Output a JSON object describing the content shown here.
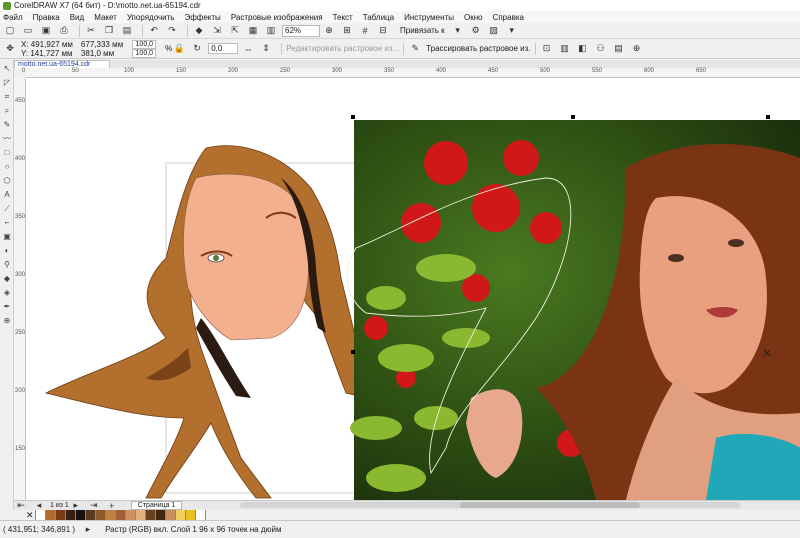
{
  "window": {
    "title": "CorelDRAW X7 (64 бит) - D:\\motto.net.ua-65194.cdr"
  },
  "menu": [
    "Файл",
    "Правка",
    "Вид",
    "Макет",
    "Упорядочить",
    "Эффекты",
    "Растровые изображения",
    "Текст",
    "Таблица",
    "Инструменты",
    "Окно",
    "Справка"
  ],
  "toolbar": {
    "zoom": "62%",
    "snap_label": "Привязать к"
  },
  "property_bar": {
    "x": "X: 491,927 мм",
    "y": "Y: 141,727 мм",
    "width": "677,333 мм",
    "height": "381,0 мм",
    "scale_x": "100,0",
    "scale_y": "100,0",
    "percent": "%",
    "angle": "0,0",
    "edit_bitmap": "Редактировать растровое из...",
    "trace_bitmap": "Трассировать растровое из."
  },
  "document_tab": "motto.net.ua-65194.cdr",
  "page_nav": {
    "counter": "1 из 1",
    "page_tab": "Страница 1"
  },
  "status": {
    "cursor": "( 431,951; 346,891 )",
    "info": "Растр (RGB) вкл. Слой 1 96 x 96 точек на дюйм"
  },
  "palette": [
    "#ffffff",
    "#b56a2e",
    "#7a3c14",
    "#3a2010",
    "#1a1210",
    "#5a3a20",
    "#8a5a2a",
    "#c08040",
    "#a0603a",
    "#d09060",
    "#e0b080",
    "#6a4020",
    "#402810",
    "#c89060",
    "#f0d060",
    "#e8c020",
    "#ffffff"
  ],
  "ruler_ticks": [
    "0",
    "50",
    "100",
    "150",
    "200",
    "250",
    "300",
    "350",
    "400",
    "450",
    "500",
    "550",
    "600",
    "650"
  ],
  "ruler_v_ticks": [
    "450",
    "400",
    "350",
    "300",
    "250",
    "200",
    "150"
  ]
}
